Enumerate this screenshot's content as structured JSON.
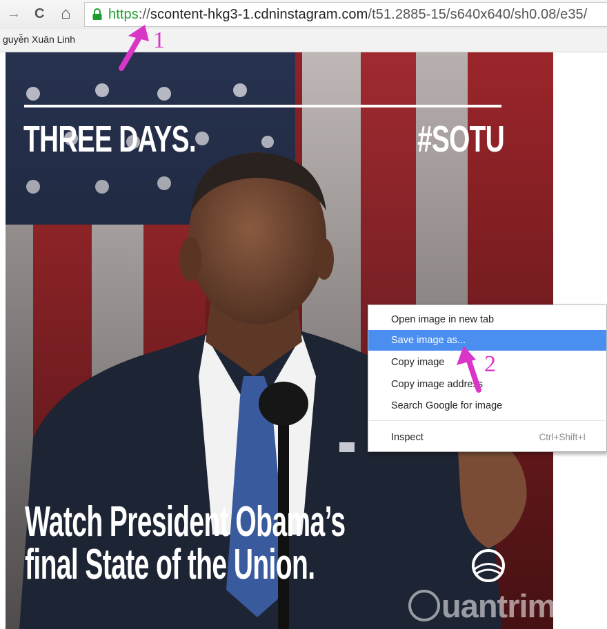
{
  "browser": {
    "nav_glyphs": {
      "forward": "→",
      "reload": "C",
      "home": "⌂"
    },
    "url": {
      "scheme": "https",
      "separator": "://",
      "host": "scontent-hkg3-1.cdninstagram.com",
      "path": "/t51.2885-15/s640x640/sh0.08/e35/"
    },
    "bookmark_label": "guyễn Xuân Linh"
  },
  "image": {
    "headline_top_left": "THREE DAYS.",
    "headline_top_right": "#SOTU",
    "headline_bottom_line1": "Watch President Obama’s",
    "headline_bottom_line2": "final State of the Union."
  },
  "context_menu": {
    "items": [
      {
        "label": "Open image in new tab",
        "shortcut": "",
        "highlighted": false
      },
      {
        "label": "Save image as...",
        "shortcut": "",
        "highlighted": true
      },
      {
        "label": "Copy image",
        "shortcut": "",
        "highlighted": false
      },
      {
        "label": "Copy image address",
        "shortcut": "",
        "highlighted": false
      },
      {
        "label": "Search Google for image",
        "shortcut": "",
        "highlighted": false
      },
      {
        "label": "Inspect",
        "shortcut": "Ctrl+Shift+I",
        "highlighted": false
      }
    ]
  },
  "annotations": {
    "step1": "1",
    "step2": "2",
    "arrow_color": "#d936c8"
  },
  "watermark": {
    "text": "uantrimang"
  },
  "colors": {
    "url_scheme": "#1f9d2c",
    "menu_highlight": "#4a8ef0",
    "flag_red": "#a82a2f",
    "flag_blue": "#27324f",
    "suit": "#1d2433",
    "tie": "#3a5a9e"
  }
}
